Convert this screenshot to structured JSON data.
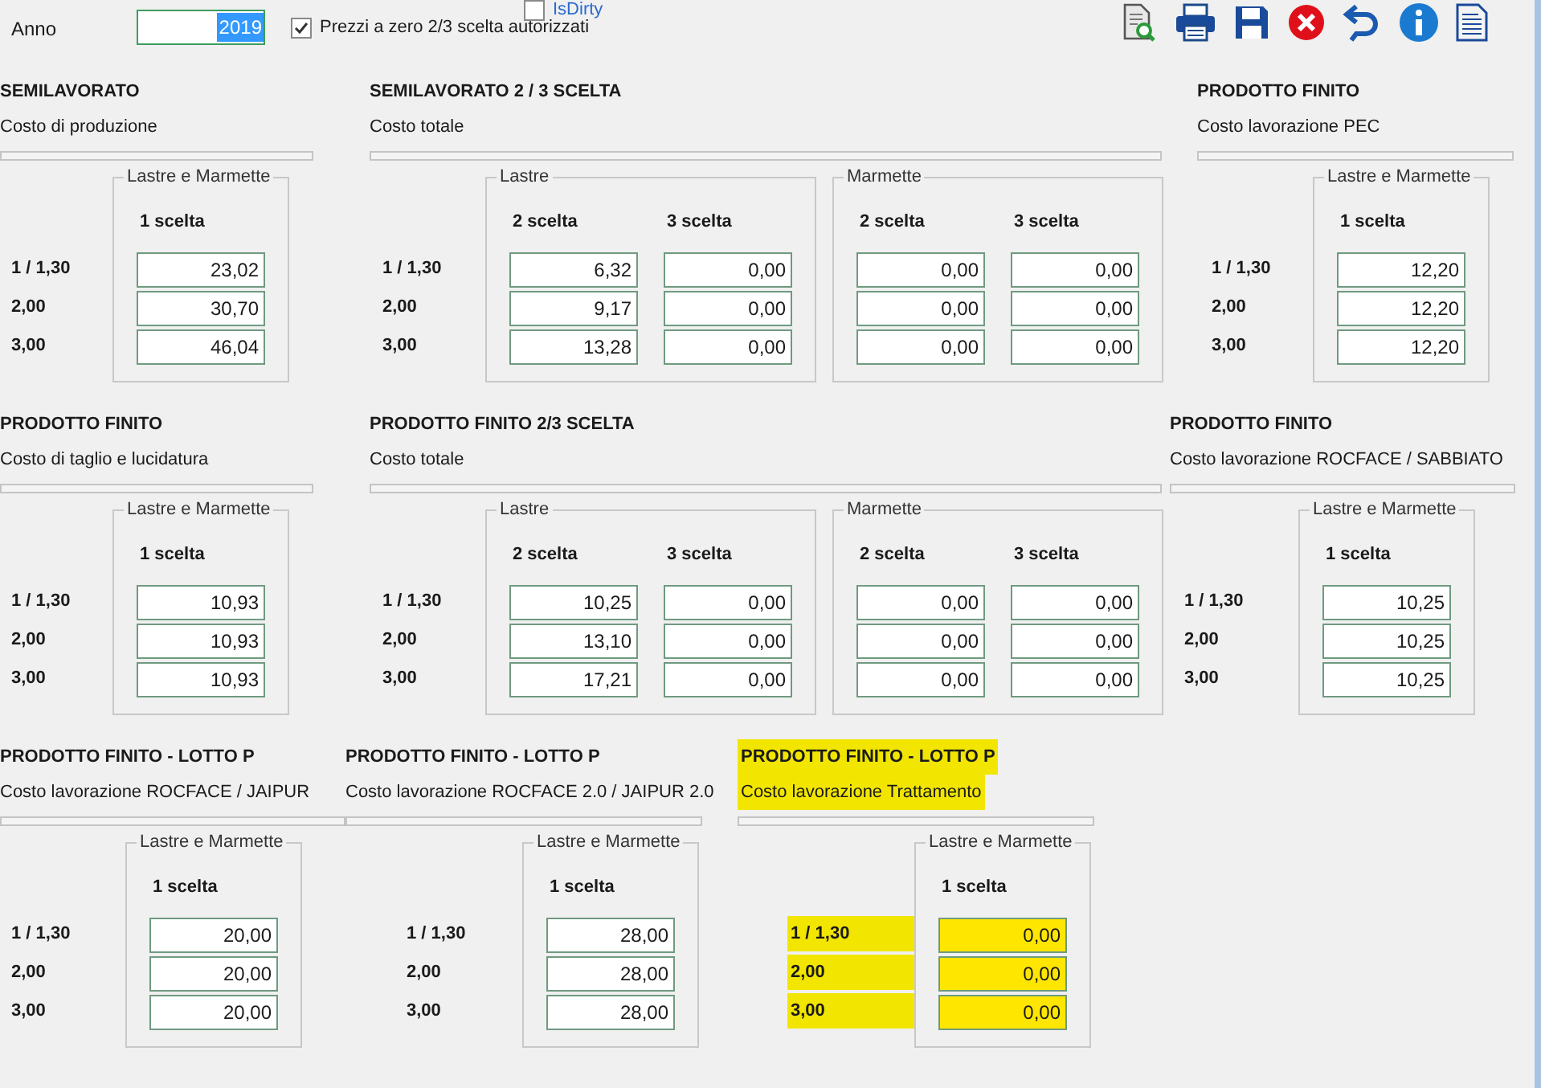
{
  "header": {
    "year": {
      "label": "Anno",
      "value": "2019",
      "text_selected": true
    },
    "zero_price_option": {
      "label": "Prezzi a zero 2/3 scelta autorizzati",
      "checked": true
    },
    "dirty_flag": {
      "label": "IsDirty",
      "checked": false
    }
  },
  "sections": [
    {
      "title": "SEMILAVORATO",
      "subtitle": "Costo di produzione",
      "highlighted": false,
      "row_labels": [
        "1 / 1,30",
        "2,00",
        "3,00"
      ],
      "groups": [
        {
          "label": "Lastre e Marmette",
          "columns": [
            {
              "header": "1 scelta",
              "values": [
                "23,02",
                "30,70",
                "46,04"
              ]
            }
          ]
        }
      ]
    },
    {
      "title": "SEMILAVORATO 2 / 3 SCELTA",
      "subtitle": "Costo totale",
      "highlighted": false,
      "row_labels": [
        "1 / 1,30",
        "2,00",
        "3,00"
      ],
      "groups": [
        {
          "label": "Lastre",
          "columns": [
            {
              "header": "2 scelta",
              "values": [
                "6,32",
                "9,17",
                "13,28"
              ]
            },
            {
              "header": "3 scelta",
              "values": [
                "0,00",
                "0,00",
                "0,00"
              ]
            }
          ]
        },
        {
          "label": "Marmette",
          "columns": [
            {
              "header": "2 scelta",
              "values": [
                "0,00",
                "0,00",
                "0,00"
              ]
            },
            {
              "header": "3 scelta",
              "values": [
                "0,00",
                "0,00",
                "0,00"
              ]
            }
          ]
        }
      ]
    },
    {
      "title": "PRODOTTO FINITO",
      "subtitle": "Costo lavorazione PEC",
      "highlighted": false,
      "row_labels": [
        "1 / 1,30",
        "2,00",
        "3,00"
      ],
      "groups": [
        {
          "label": "Lastre e Marmette",
          "columns": [
            {
              "header": "1 scelta",
              "values": [
                "12,20",
                "12,20",
                "12,20"
              ]
            }
          ]
        }
      ]
    },
    {
      "title": "PRODOTTO FINITO",
      "subtitle": "Costo di taglio e lucidatura",
      "highlighted": false,
      "row_labels": [
        "1 / 1,30",
        "2,00",
        "3,00"
      ],
      "groups": [
        {
          "label": "Lastre e Marmette",
          "columns": [
            {
              "header": "1 scelta",
              "values": [
                "10,93",
                "10,93",
                "10,93"
              ]
            }
          ]
        }
      ]
    },
    {
      "title": "PRODOTTO FINITO 2/3 SCELTA",
      "subtitle": "Costo totale",
      "highlighted": false,
      "row_labels": [
        "1 / 1,30",
        "2,00",
        "3,00"
      ],
      "groups": [
        {
          "label": "Lastre",
          "columns": [
            {
              "header": "2 scelta",
              "values": [
                "10,25",
                "13,10",
                "17,21"
              ]
            },
            {
              "header": "3 scelta",
              "values": [
                "0,00",
                "0,00",
                "0,00"
              ]
            }
          ]
        },
        {
          "label": "Marmette",
          "columns": [
            {
              "header": "2 scelta",
              "values": [
                "0,00",
                "0,00",
                "0,00"
              ]
            },
            {
              "header": "3 scelta",
              "values": [
                "0,00",
                "0,00",
                "0,00"
              ]
            }
          ]
        }
      ]
    },
    {
      "title": "PRODOTTO FINITO",
      "subtitle": "Costo lavorazione ROCFACE / SABBIATO",
      "highlighted": false,
      "row_labels": [
        "1 / 1,30",
        "2,00",
        "3,00"
      ],
      "groups": [
        {
          "label": "Lastre e Marmette",
          "columns": [
            {
              "header": "1 scelta",
              "values": [
                "10,25",
                "10,25",
                "10,25"
              ]
            }
          ]
        }
      ]
    },
    {
      "title": "PRODOTTO FINITO - LOTTO P",
      "subtitle": "Costo lavorazione ROCFACE / JAIPUR",
      "highlighted": false,
      "row_labels": [
        "1 / 1,30",
        "2,00",
        "3,00"
      ],
      "groups": [
        {
          "label": "Lastre e Marmette",
          "columns": [
            {
              "header": "1 scelta",
              "values": [
                "20,00",
                "20,00",
                "20,00"
              ]
            }
          ]
        }
      ]
    },
    {
      "title": "PRODOTTO FINITO - LOTTO P",
      "subtitle": "Costo lavorazione ROCFACE 2.0 / JAIPUR 2.0",
      "highlighted": false,
      "row_labels": [
        "1 / 1,30",
        "2,00",
        "3,00"
      ],
      "groups": [
        {
          "label": "Lastre e Marmette",
          "columns": [
            {
              "header": "1 scelta",
              "values": [
                "28,00",
                "28,00",
                "28,00"
              ]
            }
          ]
        }
      ]
    },
    {
      "title": "PRODOTTO FINITO - LOTTO P",
      "subtitle": "Costo lavorazione Trattamento",
      "highlighted": true,
      "row_labels": [
        "1 / 1,30",
        "2,00",
        "3,00"
      ],
      "groups": [
        {
          "label": "Lastre e Marmette",
          "columns": [
            {
              "header": "1 scelta",
              "values": [
                "0,00",
                "0,00",
                "0,00"
              ]
            }
          ]
        }
      ]
    }
  ]
}
